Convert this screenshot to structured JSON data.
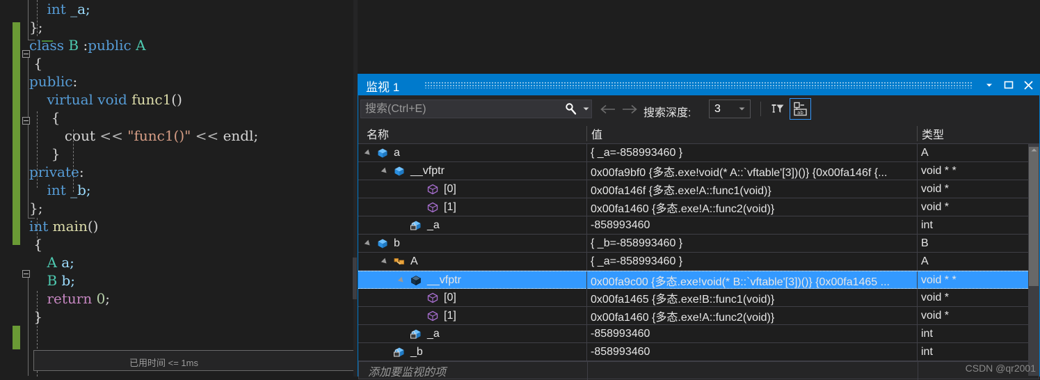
{
  "editor": {
    "lines": [
      {
        "indent": 4,
        "tokens": [
          {
            "t": "int ",
            "c": "kw"
          },
          {
            "t": "_a;",
            "c": "var"
          }
        ]
      },
      {
        "indent": 0,
        "tokens": [
          {
            "t": "};",
            "c": "pun"
          }
        ]
      },
      {
        "indent": 0,
        "tokens": [
          {
            "t": "class ",
            "c": "kw"
          },
          {
            "t": "B ",
            "c": "typ"
          },
          {
            "t": ":",
            "c": "pun"
          },
          {
            "t": "public ",
            "c": "kw"
          },
          {
            "t": "A",
            "c": "typ"
          }
        ]
      },
      {
        "indent": 1,
        "tokens": [
          {
            "t": "{",
            "c": "pun"
          }
        ]
      },
      {
        "indent": 0,
        "tokens": [
          {
            "t": "public",
            "c": "kw"
          },
          {
            "t": ":",
            "c": "pun"
          }
        ]
      },
      {
        "indent": 4,
        "tokens": [
          {
            "t": "virtual ",
            "c": "kw"
          },
          {
            "t": "void ",
            "c": "kw"
          },
          {
            "t": "func1",
            "c": "fn"
          },
          {
            "t": "()",
            "c": "pun"
          }
        ]
      },
      {
        "indent": 5,
        "tokens": [
          {
            "t": "{",
            "c": "pun"
          }
        ]
      },
      {
        "indent": 8,
        "tokens": [
          {
            "t": "cout ",
            "c": "plain"
          },
          {
            "t": "<< ",
            "c": "op"
          },
          {
            "t": "\"func1()\"",
            "c": "str"
          },
          {
            "t": " << ",
            "c": "op"
          },
          {
            "t": "endl;",
            "c": "plain"
          }
        ]
      },
      {
        "indent": 5,
        "tokens": [
          {
            "t": "}",
            "c": "pun"
          }
        ]
      },
      {
        "indent": 0,
        "tokens": [
          {
            "t": "private",
            "c": "kw"
          },
          {
            "t": ":",
            "c": "pun"
          }
        ]
      },
      {
        "indent": 4,
        "tokens": [
          {
            "t": "int ",
            "c": "kw"
          },
          {
            "t": "_b;",
            "c": "var"
          }
        ]
      },
      {
        "indent": 0,
        "tokens": [
          {
            "t": "};",
            "c": "pun"
          }
        ]
      },
      {
        "indent": 0,
        "tokens": [
          {
            "t": "int ",
            "c": "kw"
          },
          {
            "t": "main",
            "c": "fn"
          },
          {
            "t": "()",
            "c": "pun"
          }
        ]
      },
      {
        "indent": 1,
        "tokens": [
          {
            "t": "{",
            "c": "pun"
          }
        ]
      },
      {
        "indent": 4,
        "tokens": [
          {
            "t": "A ",
            "c": "typ"
          },
          {
            "t": "a;",
            "c": "var"
          }
        ]
      },
      {
        "indent": 4,
        "tokens": [
          {
            "t": "B ",
            "c": "typ"
          },
          {
            "t": "b;",
            "c": "var"
          }
        ]
      },
      {
        "indent": 4,
        "tokens": [
          {
            "t": "return ",
            "c": "ctl"
          },
          {
            "t": "0",
            "c": "num"
          },
          {
            "t": ";",
            "c": "pun"
          }
        ]
      },
      {
        "indent": 1,
        "tokens": [
          {
            "t": "}",
            "c": "pun"
          }
        ]
      }
    ],
    "elapsed_hint": "已用时间 <= 1ms"
  },
  "watch": {
    "title": "监视 1",
    "window_buttons": [
      {
        "name": "dropdown",
        "glyph": "▾"
      },
      {
        "name": "maximize",
        "glyph": "❐"
      },
      {
        "name": "close",
        "glyph": "✕"
      }
    ],
    "toolbar": {
      "search_placeholder": "搜索(Ctrl+E)",
      "search_value": "",
      "search_icon": "magnifier-icon",
      "search_dropdown_icon": "chevron-down-icon",
      "nav_back_icon": "arrow-left-icon",
      "nav_forward_icon": "arrow-right-icon",
      "depth_label": "搜索深度:",
      "depth_value": "3",
      "depth_caret_icon": "chevron-down-icon",
      "pin_filter_icon": "pin-filter-icon",
      "hex_display_icon": "hex-display-icon"
    },
    "columns": [
      {
        "key": "name",
        "label": "名称"
      },
      {
        "key": "value",
        "label": "值"
      },
      {
        "key": "type",
        "label": "类型"
      }
    ],
    "rows": [
      {
        "depth": 1,
        "expander": "open",
        "icon": "struct-blue-icon",
        "name": "a",
        "value": "{ _a=-858993460 }",
        "type": "A",
        "selected": false
      },
      {
        "depth": 2,
        "expander": "open",
        "icon": "struct-blue-icon",
        "name": "__vfptr",
        "value": "0x00fa9bf0 {多态.exe!void(* A::`vftable'[3])()} {0x00fa146f {...",
        "type": "void * *",
        "selected": false
      },
      {
        "depth": 4,
        "expander": "none",
        "icon": "element-purple-icon",
        "name": "[0]",
        "value": "0x00fa146f {多态.exe!A::func1(void)}",
        "type": "void *",
        "selected": false
      },
      {
        "depth": 4,
        "expander": "none",
        "icon": "element-purple-icon",
        "name": "[1]",
        "value": "0x00fa1460 {多态.exe!A::func2(void)}",
        "type": "void *",
        "selected": false
      },
      {
        "depth": 3,
        "expander": "none",
        "icon": "field-private-icon",
        "name": "_a",
        "value": "-858993460",
        "type": "int",
        "selected": false
      },
      {
        "depth": 1,
        "expander": "open",
        "icon": "struct-blue-icon",
        "name": "b",
        "value": "{ _b=-858993460 }",
        "type": "B",
        "selected": false
      },
      {
        "depth": 2,
        "expander": "open",
        "icon": "base-class-icon",
        "name": "A",
        "value": "{ _a=-858993460 }",
        "type": "A",
        "selected": false
      },
      {
        "depth": 3,
        "expander": "open",
        "icon": "struct-dark-icon",
        "name": "__vfptr",
        "value": "0x00fa9c00 {多态.exe!void(* B::`vftable'[3])()} {0x00fa1465 ...",
        "type": "void * *",
        "selected": true
      },
      {
        "depth": 4,
        "expander": "none",
        "icon": "element-purple-icon",
        "name": "[0]",
        "value": "0x00fa1465 {多态.exe!B::func1(void)}",
        "type": "void *",
        "selected": false
      },
      {
        "depth": 4,
        "expander": "none",
        "icon": "element-purple-icon",
        "name": "[1]",
        "value": "0x00fa1460 {多态.exe!A::func2(void)}",
        "type": "void *",
        "selected": false
      },
      {
        "depth": 3,
        "expander": "none",
        "icon": "field-private-icon",
        "name": "_a",
        "value": "-858993460",
        "type": "int",
        "selected": false
      },
      {
        "depth": 2,
        "expander": "none",
        "icon": "field-private-icon",
        "name": "_b",
        "value": "-858993460",
        "type": "int",
        "selected": false
      }
    ],
    "add_row_placeholder": "添加要监视的项"
  },
  "watermark": "CSDN @qr2001",
  "colors": {
    "accent": "#007acc",
    "selection": "#3399ff",
    "panel_bg": "#252526",
    "grid_bg": "#1e1e1e",
    "grid_line": "#3f3f46",
    "change_bar": "#6a9a35"
  }
}
